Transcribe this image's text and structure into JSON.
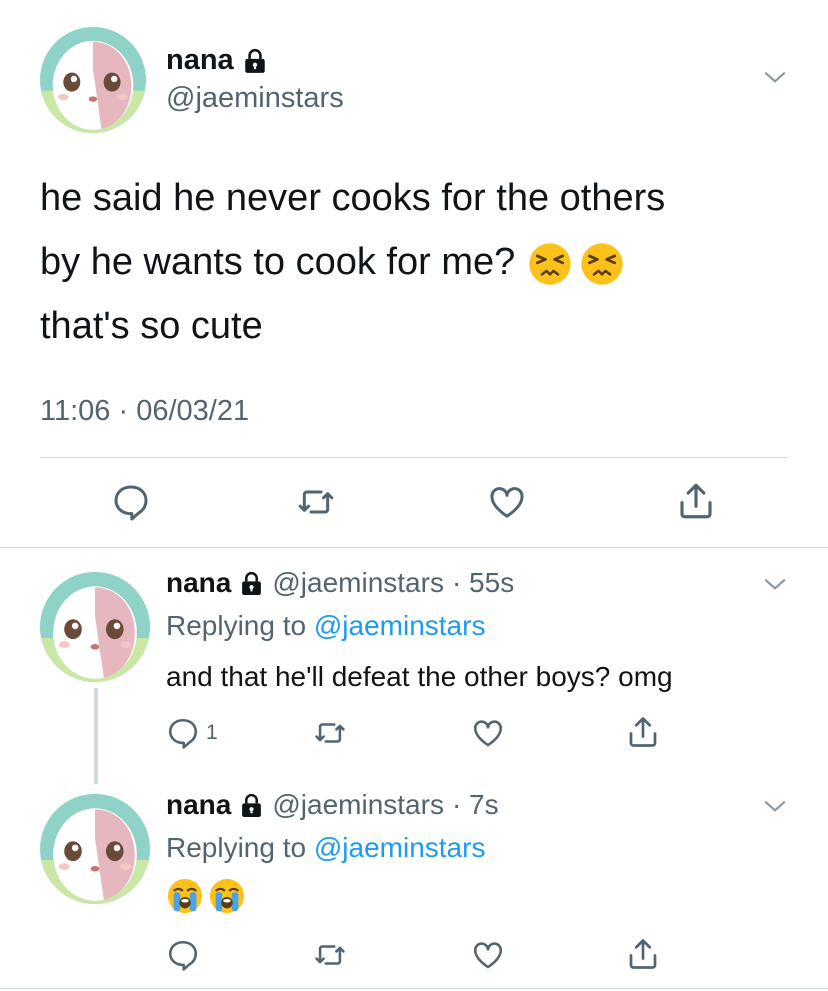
{
  "main_tweet": {
    "display_name": "nana",
    "handle": "@jaeminstars",
    "text_lines": [
      "he said he never cooks for the others",
      "by he wants to cook for me?",
      "that's so cute"
    ],
    "emojis": [
      "persevering-face",
      "persevering-face"
    ],
    "timestamp": "11:06 · 06/03/21",
    "actions": [
      "reply-icon",
      "retweet-icon",
      "like-icon",
      "share-icon"
    ]
  },
  "replies": [
    {
      "display_name": "nana",
      "handle": "@jaeminstars",
      "time": "· 55s",
      "replying_prefix": "Replying to",
      "replying_to": "@jaeminstars",
      "text": "and that he'll defeat the other boys? omg",
      "reply_count": "1"
    },
    {
      "display_name": "nana",
      "handle": "@jaeminstars",
      "time": "· 7s",
      "replying_prefix": "Replying to",
      "replying_to": "@jaeminstars",
      "emojis": [
        "loudly-crying-face",
        "loudly-crying-face"
      ]
    }
  ],
  "colors": {
    "link": "#1d9bf0",
    "muted": "#536471",
    "divider": "#cfd9de",
    "text": "#0f1419"
  }
}
